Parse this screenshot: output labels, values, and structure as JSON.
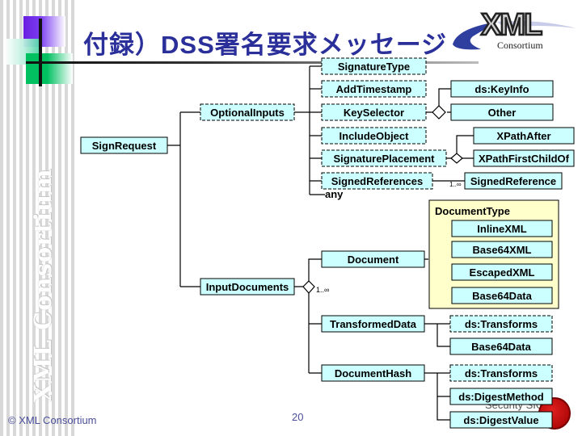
{
  "slide": {
    "title": "付録）DSS署名要求メッセージ",
    "vertical_brand": "XML Consortium",
    "copyright": "© XML Consortium",
    "page_number": "20",
    "logo_big": "XML",
    "logo_small": "Consortium",
    "watermark": "Security SIG"
  },
  "colors": {
    "node_fill": "#ccffff",
    "group_fill": "#ffffcc",
    "title": "#2a2f9a",
    "line": "#000000"
  },
  "diagram": {
    "nodes": {
      "sign_request": {
        "label": "SignRequest",
        "style": "solid"
      },
      "optional_inputs": {
        "label": "OptionalInputs",
        "style": "dashed"
      },
      "signature_type": {
        "label": "SignatureType",
        "style": "dashed"
      },
      "add_timestamp": {
        "label": "AddTimestamp",
        "style": "dashed"
      },
      "key_selector": {
        "label": "KeySelector",
        "style": "dashed"
      },
      "include_object": {
        "label": "IncludeObject",
        "style": "dashed"
      },
      "signature_placement": {
        "label": "SignaturePlacement",
        "style": "dashed"
      },
      "signed_references": {
        "label": "SignedReferences",
        "style": "dashed"
      },
      "any": {
        "label": "any"
      },
      "ds_keyinfo": {
        "label": "ds:KeyInfo",
        "style": "solid"
      },
      "other": {
        "label": "Other",
        "style": "solid"
      },
      "xpath_after": {
        "label": "XPathAfter",
        "style": "solid"
      },
      "xpath_first_child_of": {
        "label": "XPathFirstChildOf",
        "style": "solid"
      },
      "signed_reference": {
        "label": "SignedReference",
        "style": "solid"
      },
      "document_type_group": {
        "label": "DocumentType"
      },
      "inline_xml": {
        "label": "InlineXML",
        "style": "solid"
      },
      "base64_xml": {
        "label": "Base64XML",
        "style": "solid"
      },
      "escaped_xml": {
        "label": "EscapedXML",
        "style": "solid"
      },
      "base64_data_1": {
        "label": "Base64Data",
        "style": "solid"
      },
      "document": {
        "label": "Document",
        "style": "solid"
      },
      "input_documents": {
        "label": "InputDocuments",
        "style": "solid"
      },
      "transformed_data": {
        "label": "TransformedData",
        "style": "solid"
      },
      "ds_transforms_1": {
        "label": "ds:Transforms",
        "style": "dashed"
      },
      "base64_data_2": {
        "label": "Base64Data",
        "style": "solid"
      },
      "document_hash": {
        "label": "DocumentHash",
        "style": "solid"
      },
      "ds_transforms_2": {
        "label": "ds:Transforms",
        "style": "dashed"
      },
      "ds_digest_method": {
        "label": "ds:DigestMethod",
        "style": "solid"
      },
      "ds_digest_value": {
        "label": "ds:DigestValue",
        "style": "solid"
      }
    },
    "multiplicities": {
      "signed_reference": "1..∞",
      "input_documents": "1..∞"
    }
  }
}
